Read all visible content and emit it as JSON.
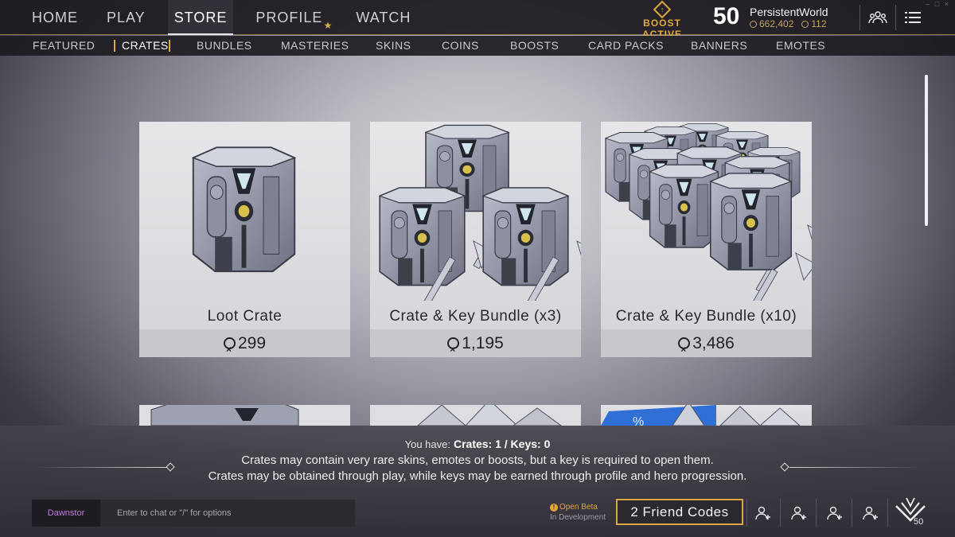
{
  "top_nav": {
    "items": [
      {
        "label": "HOME"
      },
      {
        "label": "PLAY"
      },
      {
        "label": "STORE"
      },
      {
        "label": "PROFILE"
      },
      {
        "label": "WATCH"
      }
    ],
    "active": "STORE"
  },
  "boost": {
    "label": "BOOST ACTIVE",
    "icon": "boost-diamond-icon"
  },
  "player": {
    "level": "50",
    "name": "PersistentWorld",
    "currency_primary": "662,402",
    "currency_secondary": "112"
  },
  "sub_nav": {
    "items": [
      {
        "label": "FEATURED"
      },
      {
        "label": "CRATES"
      },
      {
        "label": "BUNDLES"
      },
      {
        "label": "MASTERIES"
      },
      {
        "label": "SKINS"
      },
      {
        "label": "COINS"
      },
      {
        "label": "BOOSTS"
      },
      {
        "label": "CARD PACKS"
      },
      {
        "label": "BANNERS"
      },
      {
        "label": "EMOTES"
      }
    ],
    "active": "CRATES"
  },
  "store_items": [
    {
      "title": "Loot Crate",
      "price": "299"
    },
    {
      "title": "Crate & Key Bundle (x3)",
      "price": "1,195"
    },
    {
      "title": "Crate & Key Bundle (x10)",
      "price": "3,486"
    }
  ],
  "inventory": {
    "prefix": "You have:",
    "value": "Crates: 1 / Keys: 0"
  },
  "info_lines": [
    "Crates may contain very rare skins, emotes or boosts, but a key is required to open them.",
    "Crates may be obtained through play, while keys may be earned through profile and hero progression."
  ],
  "chat": {
    "name": "Dawnstor",
    "placeholder": "Enter to chat or \"/\" for options"
  },
  "status": {
    "line1": "Open Beta",
    "line2": "In Development"
  },
  "friend_codes_label": "2 Friend Codes",
  "rank_badge": "50",
  "colors": {
    "accent_gold": "#d9a640",
    "bar_bg": "#1c1a20",
    "chat_name": "#c17ad9"
  }
}
